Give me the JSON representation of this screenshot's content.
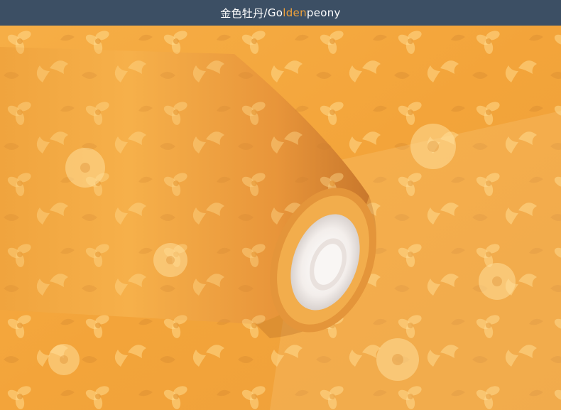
{
  "header": {
    "title_cn": "金色牡丹",
    "separator": "/",
    "title_en_a": "Go",
    "title_en_highlight": "lden",
    "title_en_b": " peony"
  },
  "colors": {
    "header_bg": "#3c4f64",
    "header_text": "#ffffff",
    "highlight": "#f0a23a",
    "paper_base": "#f3a43a",
    "paper_light": "#ffd98a",
    "paper_shadow": "#d8852a",
    "core_white": "#f6f1ee"
  },
  "image": {
    "subject": "rolled golden embossed peony-pattern wallpaper",
    "icons": [
      "flower-pattern",
      "wallpaper-roll-core"
    ]
  }
}
